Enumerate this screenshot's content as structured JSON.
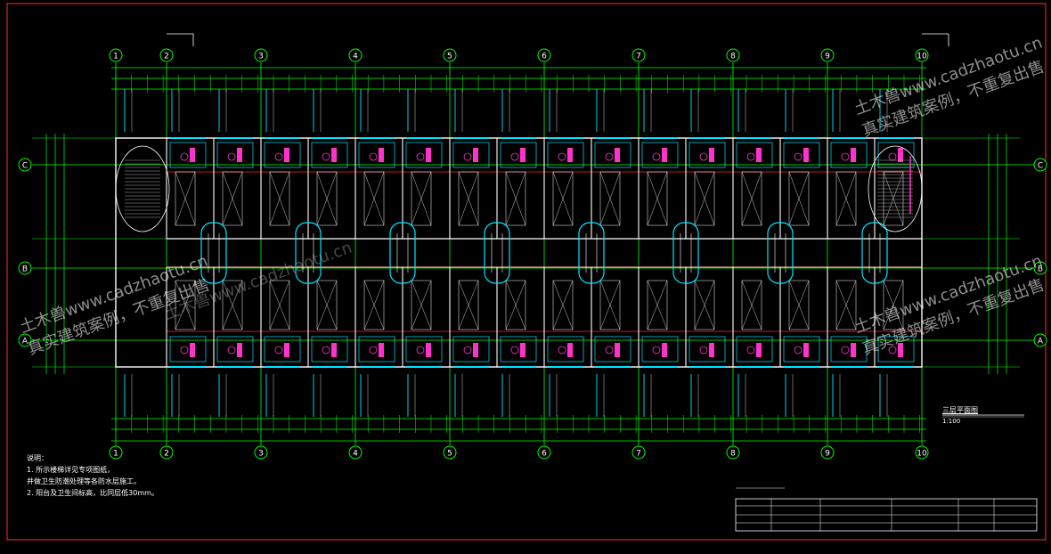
{
  "drawing": {
    "axis_numbers": [
      "1",
      "2",
      "3",
      "4",
      "5",
      "6",
      "7",
      "8",
      "9",
      "10"
    ],
    "axis_letters": [
      "C",
      "B",
      "A"
    ],
    "colors": {
      "frame": "#ff3030",
      "axis_line": "#00ff00",
      "wall": "#ffffff",
      "grid_red": "#ff2020",
      "window_cyan": "#00e5ff",
      "door_magenta": "#ff33cc",
      "dim_green": "#00ff00",
      "stair_white": "#d0d0d0"
    },
    "plan_title": "三层平面图",
    "plan_scale": "1:100"
  },
  "watermarks": [
    {
      "line1": "土木兽www.cadzhaotu.cn",
      "line2": "真实建筑案例，不重复出售"
    },
    {
      "line1": "土木兽www.cadzhaotu.cn",
      "line2": "真实建筑案例，不重复出售"
    },
    {
      "line1": "土木兽www.cadzhaotu.cn",
      "line2": "真实建筑案例，不重复出售"
    },
    {
      "line1": "土木兽www.cadzhaotu.cn",
      "line2": "真实建筑案例，不重复出售"
    }
  ],
  "notes": {
    "title": "说明：",
    "items": [
      "1. 所示楼梯详见专项图纸，",
      "   并做卫生防潮处理等各防水层施工。",
      "2. 阳台及卫生间标高，比同层低30mm。"
    ]
  }
}
